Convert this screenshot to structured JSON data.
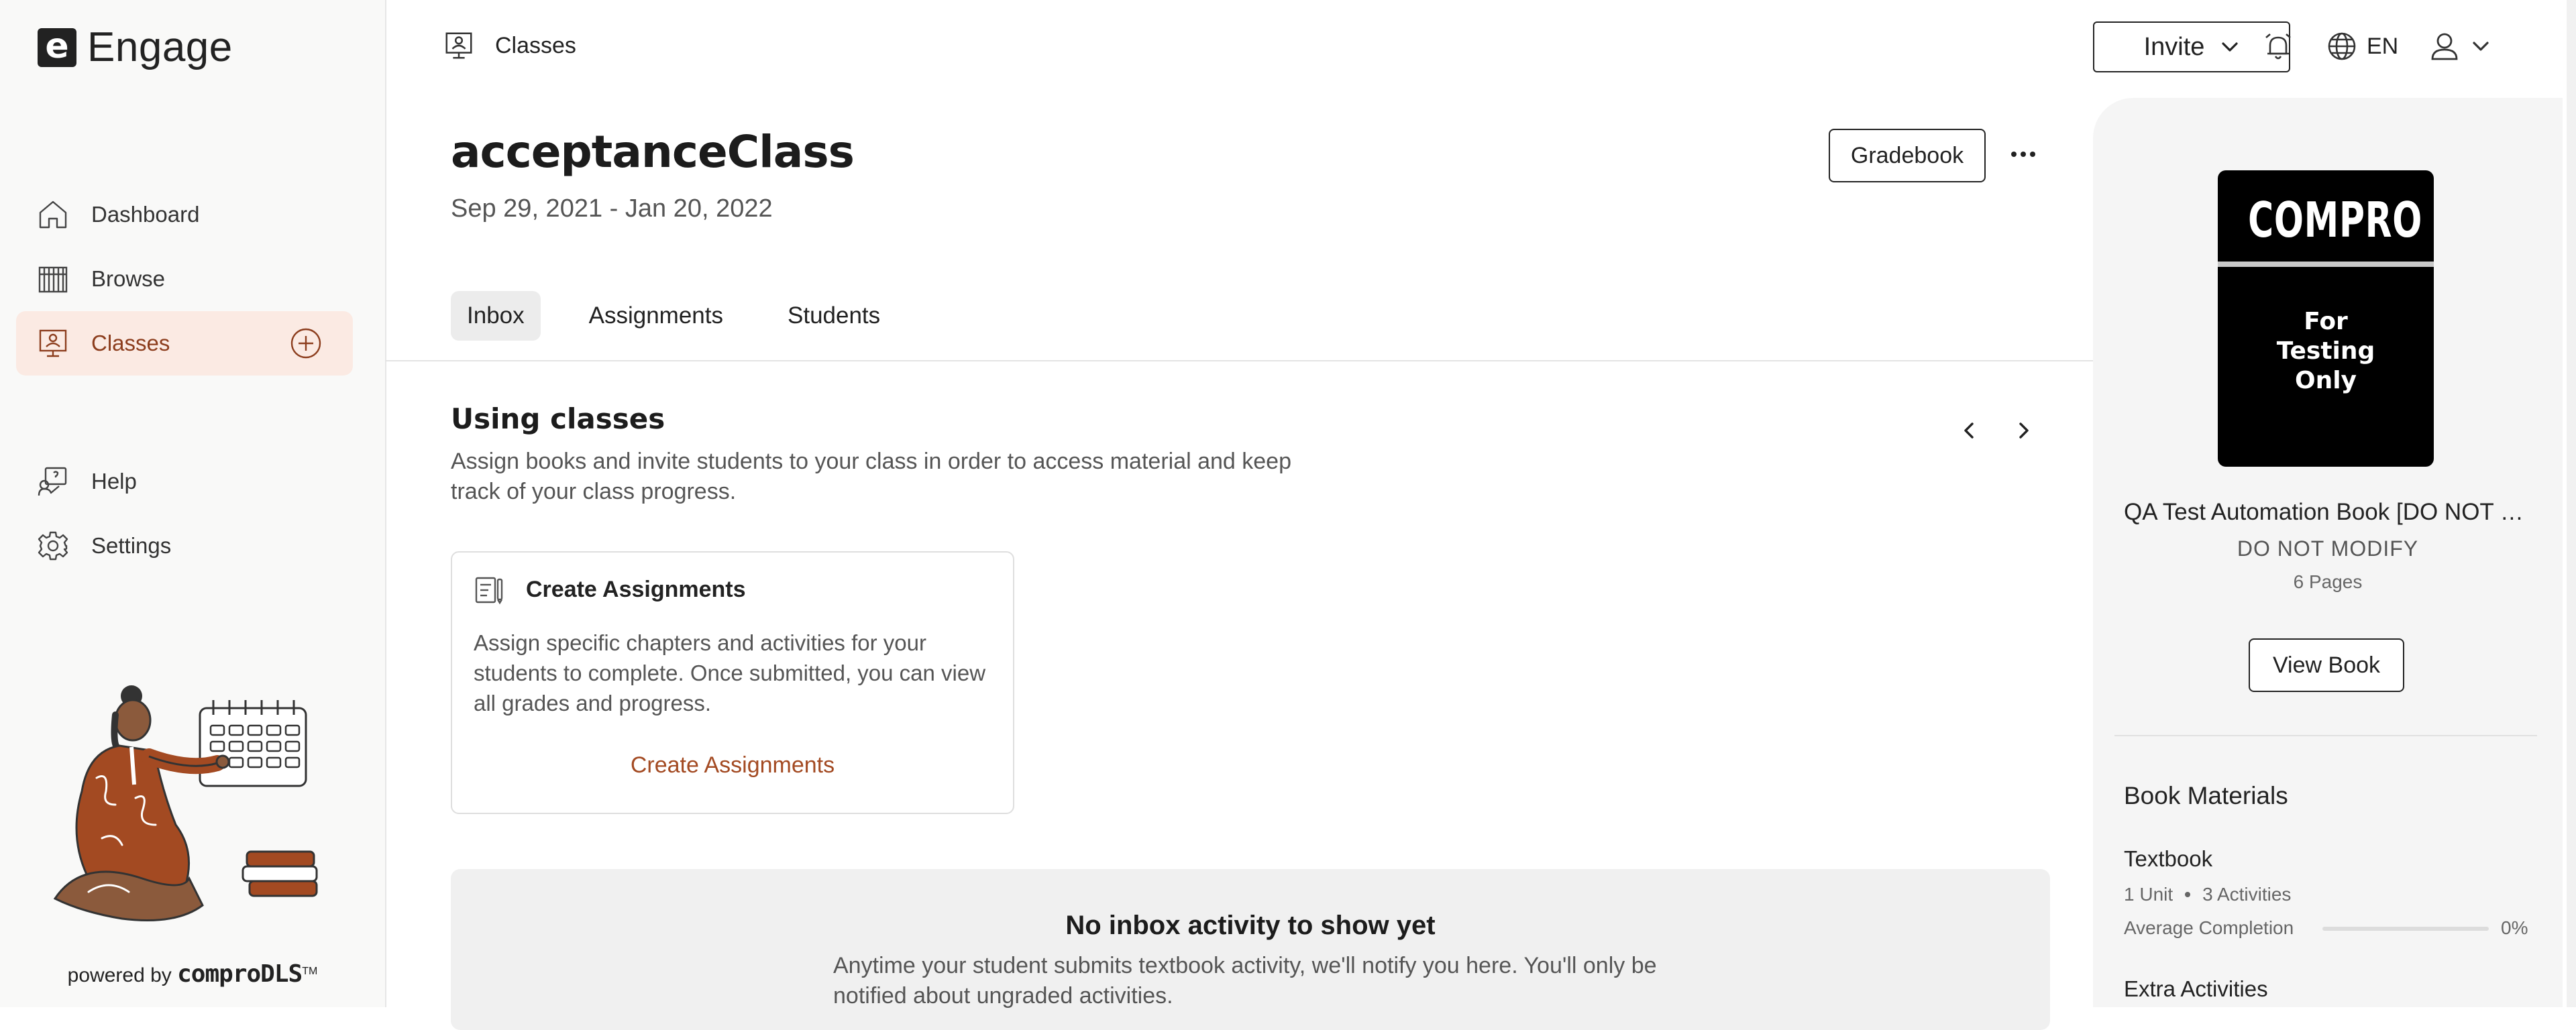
{
  "app": {
    "logo_letter": "e",
    "name": "Engage"
  },
  "sidebar": {
    "items": [
      {
        "label": "Dashboard",
        "icon": "home-icon"
      },
      {
        "label": "Browse",
        "icon": "books-icon"
      },
      {
        "label": "Classes",
        "icon": "classes-icon",
        "active": true
      },
      {
        "label": "Help",
        "icon": "help-icon"
      },
      {
        "label": "Settings",
        "icon": "gear-icon"
      }
    ],
    "powered_prefix": "powered by",
    "powered_brand": "comproDLS",
    "powered_tm": "TM"
  },
  "topbar": {
    "breadcrumb": "Classes",
    "invite_label": "Invite",
    "language": "EN"
  },
  "main": {
    "class_title": "acceptanceClass",
    "dates": "Sep 29, 2021 - Jan 20, 2022",
    "gradebook_label": "Gradebook",
    "tabs": [
      {
        "label": "Inbox",
        "active": true
      },
      {
        "label": "Assignments"
      },
      {
        "label": "Students"
      }
    ],
    "using": {
      "title": "Using classes",
      "description": "Assign books and invite students to your class in order to access material and keep track of your class progress."
    },
    "card": {
      "title": "Create Assignments",
      "body": "Assign specific chapters and activities for your students to complete. Once submitted, you can view all grades and progress.",
      "link": "Create Assignments"
    },
    "empty": {
      "title": "No inbox activity to show yet",
      "description": "Anytime your student submits textbook activity, we'll notify you here. You'll only be notified about ungraded activities."
    }
  },
  "right_panel": {
    "cover": {
      "title": "COMPRO",
      "subtitle": "For\nTesting\nOnly"
    },
    "book_title": "QA Test Automation Book [DO NOT MODIFY]",
    "book_subtitle": "DO NOT MODIFY",
    "pages": "6 Pages",
    "view_book": "View Book",
    "materials_title": "Book Materials",
    "textbook": {
      "title": "Textbook",
      "units": "1 Unit",
      "activities": "3 Activities",
      "avg_label": "Average Completion",
      "completion": 0,
      "completion_text": "0%"
    },
    "extra_title": "Extra Activities"
  },
  "colors": {
    "accent": "#a34a22",
    "active_bg": "#fbeae3",
    "active_text": "#8c3d1d"
  }
}
